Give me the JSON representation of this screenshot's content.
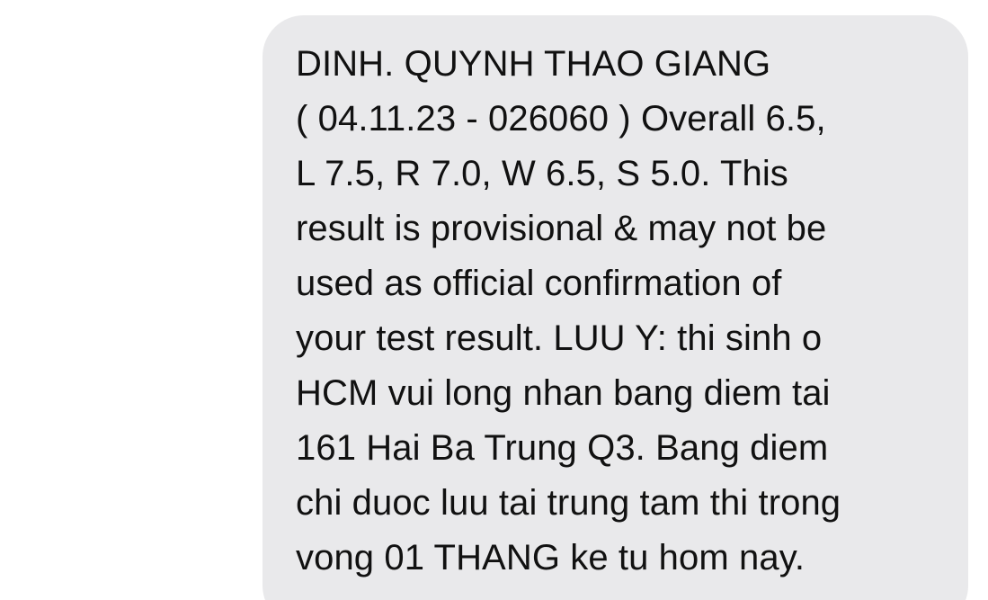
{
  "message": {
    "lines": [
      "DINH. QUYNH THAO GIANG",
      "( 04.11.23 - 026060 ) Overall 6.5,",
      "L 7.5, R 7.0, W 6.5, S 5.0. This",
      "result is provisional & may not be",
      "used as official confirmation of",
      "your test result. LUU Y: thi sinh o",
      "HCM vui long nhan bang diem tai",
      "161 Hai Ba Trung Q3. Bang diem",
      "chi duoc luu tai trung tam thi trong",
      "vong 01 THANG ke tu hom nay."
    ]
  },
  "colors": {
    "bubble_background": "#e9e9eb",
    "text": "#111111",
    "page_background": "#ffffff"
  }
}
